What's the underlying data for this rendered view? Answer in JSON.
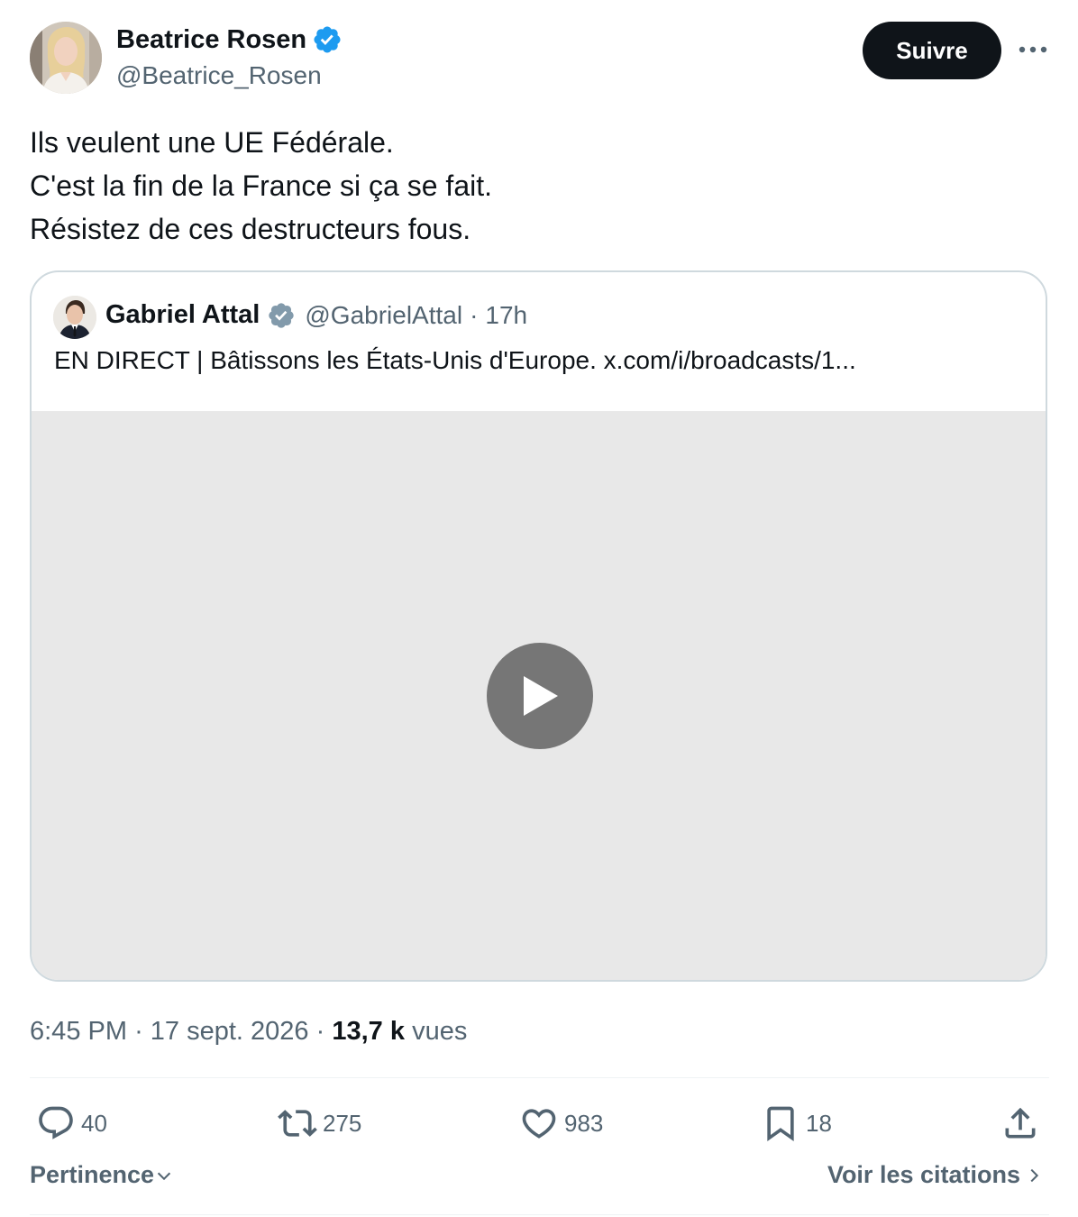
{
  "author": {
    "name": "Beatrice Rosen",
    "handle": "@Beatrice_Rosen"
  },
  "follow_label": "Suivre",
  "tweet_lines": [
    "Ils veulent une UE Fédérale.",
    "C'est la fin de la France si ça se fait.",
    "Résistez de ces destructeurs fous."
  ],
  "quote": {
    "name": "Gabriel Attal",
    "handle": "@GabrielAttal",
    "separator": "·",
    "time": "17h",
    "text": "EN DIRECT | Bâtissons les États-Unis d'Europe. x.com/i/broadcasts/1..."
  },
  "meta": {
    "time": "6:45 PM",
    "sep1": "·",
    "date": "17 sept. 2026",
    "sep2": "·",
    "views_count": "13,7 k",
    "views_label": "vues"
  },
  "actions": {
    "replies": "40",
    "reposts": "275",
    "likes": "983",
    "bookmarks": "18"
  },
  "footer": {
    "sort_label": "Pertinence",
    "quotes_label": "Voir les citations"
  },
  "colors": {
    "verified": "#1d9bf0",
    "quote_verified": "#829aab",
    "text": "#0f1419",
    "muted": "#536471",
    "follow_bg": "#0f1419",
    "media_bg": "#e8e8e8",
    "play_bg": "#767676"
  }
}
